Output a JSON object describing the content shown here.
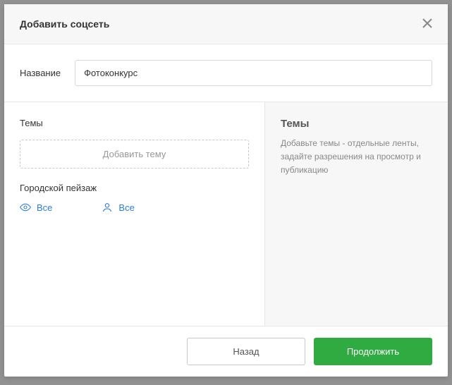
{
  "modal": {
    "title": "Добавить соцсеть"
  },
  "name": {
    "label": "Название",
    "value": "Фотоконкурс"
  },
  "themes": {
    "heading": "Темы",
    "add_button": "Добавить тему",
    "items": [
      {
        "title": "Городской пейзаж",
        "view_perm": "Все",
        "author_perm": "Все"
      }
    ]
  },
  "help": {
    "title": "Темы",
    "description": "Добавьте темы - отдельные ленты, задайте разрешения на просмотр и публикацию"
  },
  "footer": {
    "back": "Назад",
    "continue": "Продолжить"
  }
}
